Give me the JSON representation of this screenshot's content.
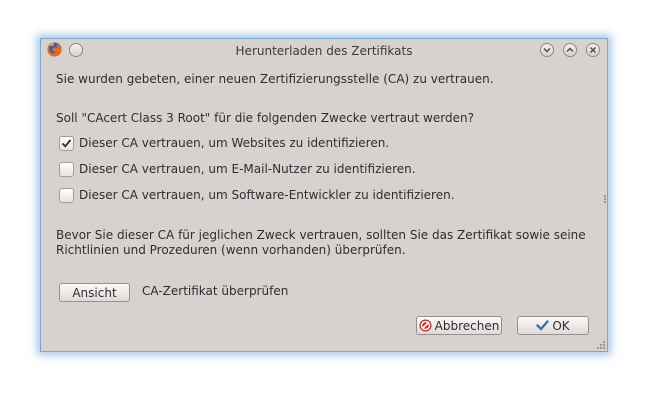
{
  "window": {
    "title": "Herunterladen des Zertifikats"
  },
  "dialog": {
    "intro": "Sie wurden gebeten, einer neuen Zertifizierungsstelle (CA) zu vertrauen.",
    "question": "Soll \"CAcert Class 3 Root\" für die folgenden Zwecke vertraut werden?",
    "options": [
      {
        "label": "Dieser CA vertrauen, um Websites zu identifizieren.",
        "checked": true
      },
      {
        "label": "Dieser CA vertrauen, um E-Mail-Nutzer zu identifizieren.",
        "checked": false
      },
      {
        "label": "Dieser CA vertrauen, um Software-Entwickler zu identifizieren.",
        "checked": false
      }
    ],
    "advice_line1": "Bevor Sie dieser CA für jeglichen Zweck vertrauen, sollten Sie das Zertifikat sowie seine",
    "advice_line2": "Richtlinien und Prozeduren (wenn vorhanden) überprüfen.",
    "view_button": "Ansicht",
    "view_label": "CA-Zertifikat überprüfen",
    "cancel_button": "Abbrechen",
    "ok_button": "OK"
  },
  "icons": {
    "app": "firefox-icon",
    "cancel": "cancel-icon",
    "ok": "checkmark-icon"
  },
  "colors": {
    "dialog_bg": "#d6d2d0",
    "focus_glow": "#5a96d2",
    "cancel_icon": "#cc2a22",
    "ok_icon": "#3d6fb2"
  }
}
